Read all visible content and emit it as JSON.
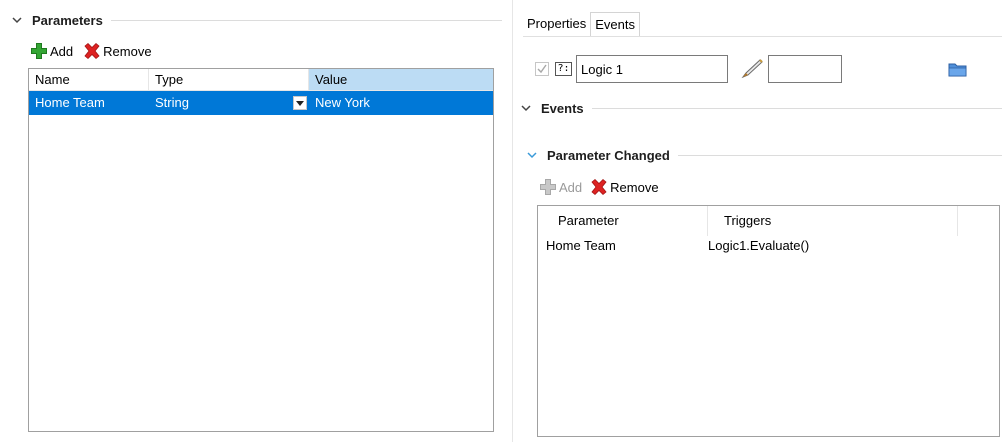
{
  "left": {
    "section_title": "Parameters",
    "toolbar": {
      "add_label": "Add",
      "remove_label": "Remove"
    },
    "table": {
      "headers": {
        "name": "Name",
        "type": "Type",
        "value": "Value"
      },
      "rows": [
        {
          "name": "Home Team",
          "type": "String",
          "value": "New York"
        }
      ]
    }
  },
  "right": {
    "tabs": [
      "Properties",
      "Events"
    ],
    "object": {
      "enabled": true,
      "type_badge": "?:",
      "name": "Logic 1",
      "number": ""
    },
    "events_section_title": "Events",
    "param_changed_section_title": "Parameter Changed",
    "toolbar": {
      "add_label": "Add",
      "remove_label": "Remove",
      "add_enabled": false
    },
    "table": {
      "headers": {
        "parameter": "Parameter",
        "triggers": "Triggers"
      },
      "rows": [
        {
          "parameter": "Home Team",
          "triggers": "Logic1.Evaluate()"
        }
      ]
    }
  },
  "colors": {
    "selection": "#0078d7",
    "value_header": "#bcdcf4",
    "add_green": "#2f9e2f",
    "remove_red": "#d21f1f"
  },
  "icons": [
    "chevron-down-icon",
    "add-icon",
    "remove-icon",
    "checkbox-icon",
    "pen-icon",
    "folder-icon"
  ]
}
